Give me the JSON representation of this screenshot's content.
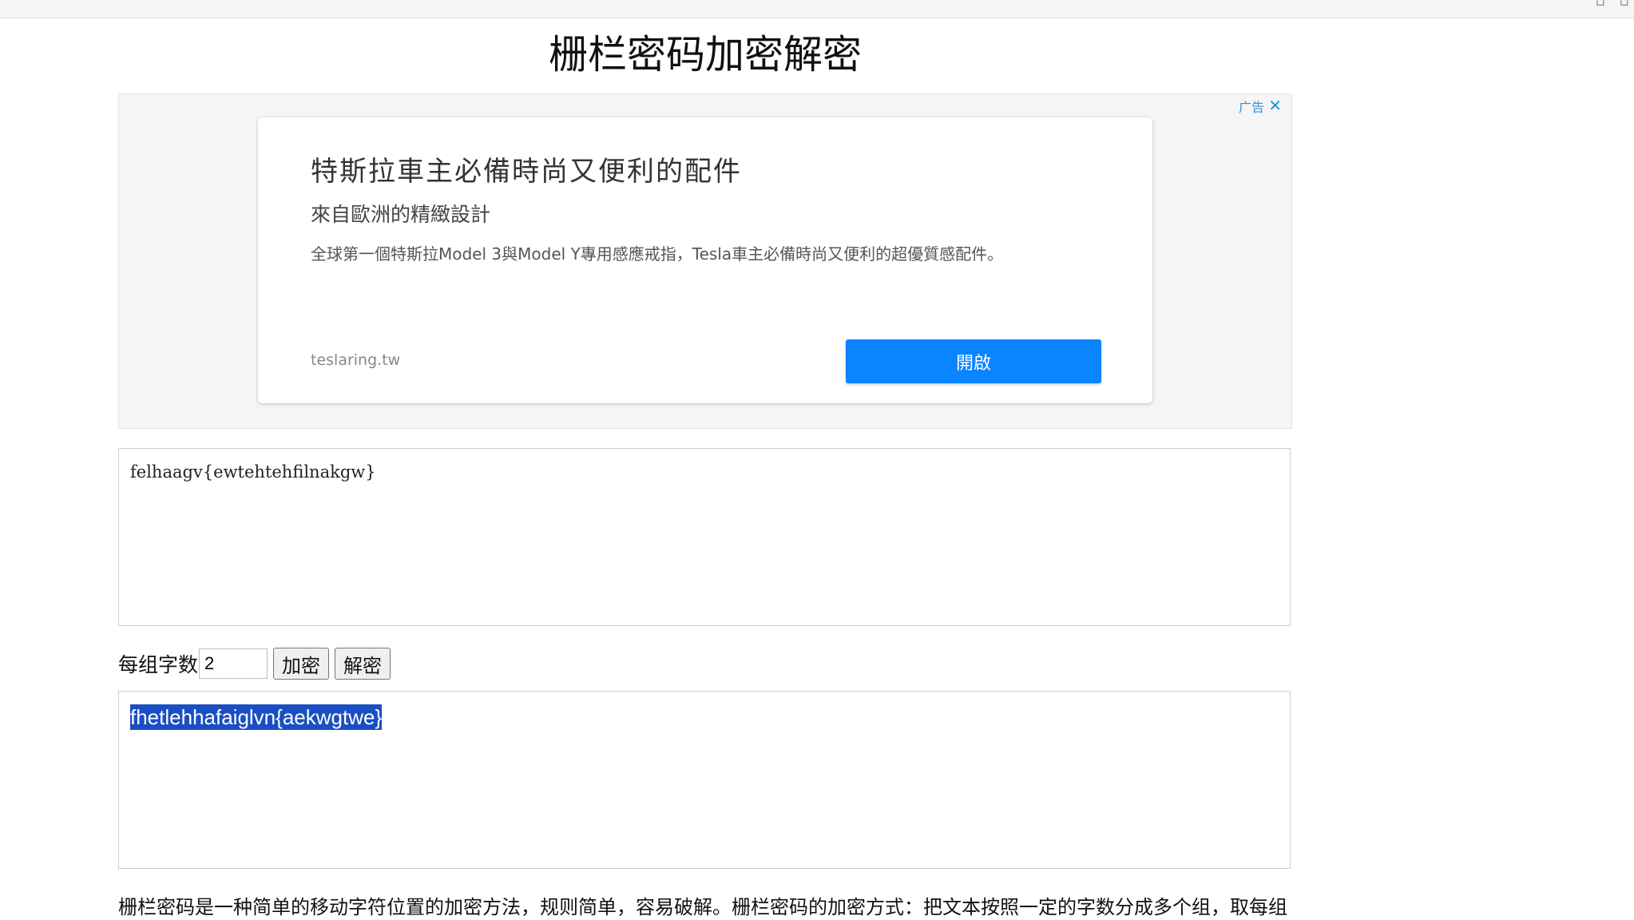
{
  "page": {
    "title": "栅栏密码加密解密"
  },
  "ad": {
    "label": "广告",
    "close_glyph": "✕",
    "headline": "特斯拉車主必備時尚又便利的配件",
    "subhead": "來自歐洲的精緻設計",
    "description": "全球第一個特斯拉Model 3與Model Y專用感應戒指，Tesla車主必備時尚又便利的超優質感配件。",
    "domain": "teslaring.tw",
    "cta_label": "開啟"
  },
  "input": {
    "value": "felhaagv{ewtehtehfilnakgw}"
  },
  "controls": {
    "group_size_label": "每组字数",
    "group_size_value": "2",
    "encrypt_label": "加密",
    "decrypt_label": "解密"
  },
  "output": {
    "value": "fhetlehhafaiglvn{aekwgtwe}"
  },
  "description": {
    "text": "栅栏密码是一种简单的移动字符位置的加密方法，规则简单，容易破解。栅栏密码的加密方式：把文本按照一定的字数分成多个组，取每组"
  },
  "icons": {
    "ad_close": "close-icon"
  },
  "colors": {
    "cta_blue": "#0a84ff",
    "selection_blue": "#1a4fc4"
  }
}
